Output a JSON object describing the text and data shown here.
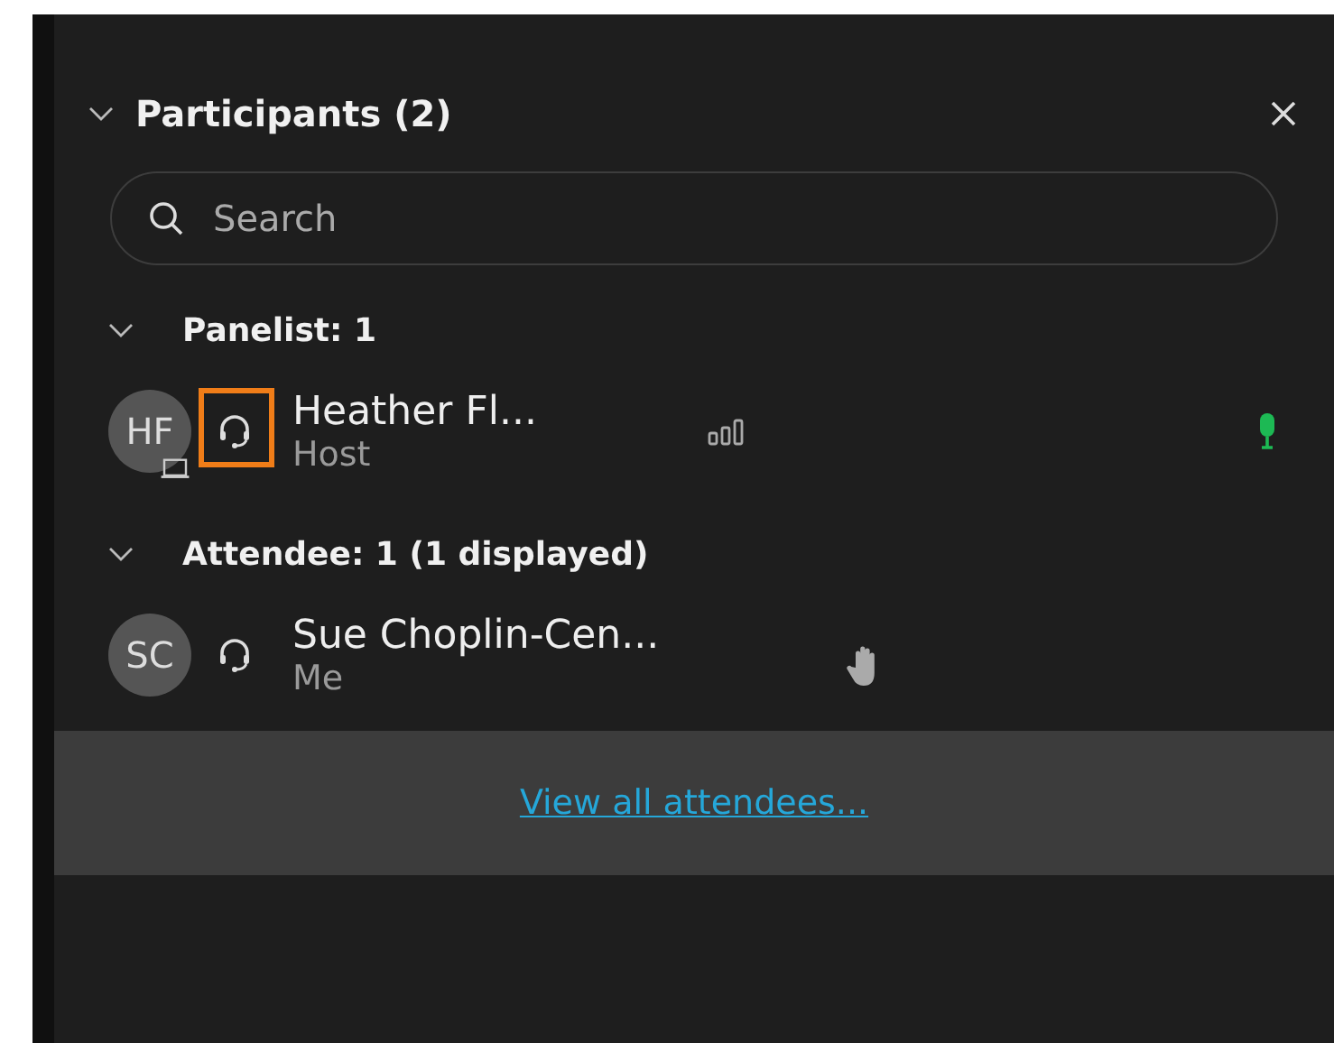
{
  "panel": {
    "title": "Participants (2)",
    "expanded": true
  },
  "search": {
    "placeholder": "Search"
  },
  "groups": [
    {
      "label": "Panelist: 1",
      "expanded": true,
      "participants": [
        {
          "initials": "HF",
          "name": "Heather Fl...",
          "role": "Host",
          "highlighted": true,
          "device": true,
          "signal": true,
          "mic_on": true,
          "hand_raised": false
        }
      ]
    },
    {
      "label": "Attendee: 1 (1 displayed)",
      "expanded": true,
      "participants": [
        {
          "initials": "SC",
          "name": "Sue Choplin-Cen...",
          "role": "Me",
          "highlighted": false,
          "device": false,
          "signal": false,
          "mic_on": false,
          "hand_raised": true
        }
      ]
    }
  ],
  "footer": {
    "link": "View all attendees..."
  }
}
